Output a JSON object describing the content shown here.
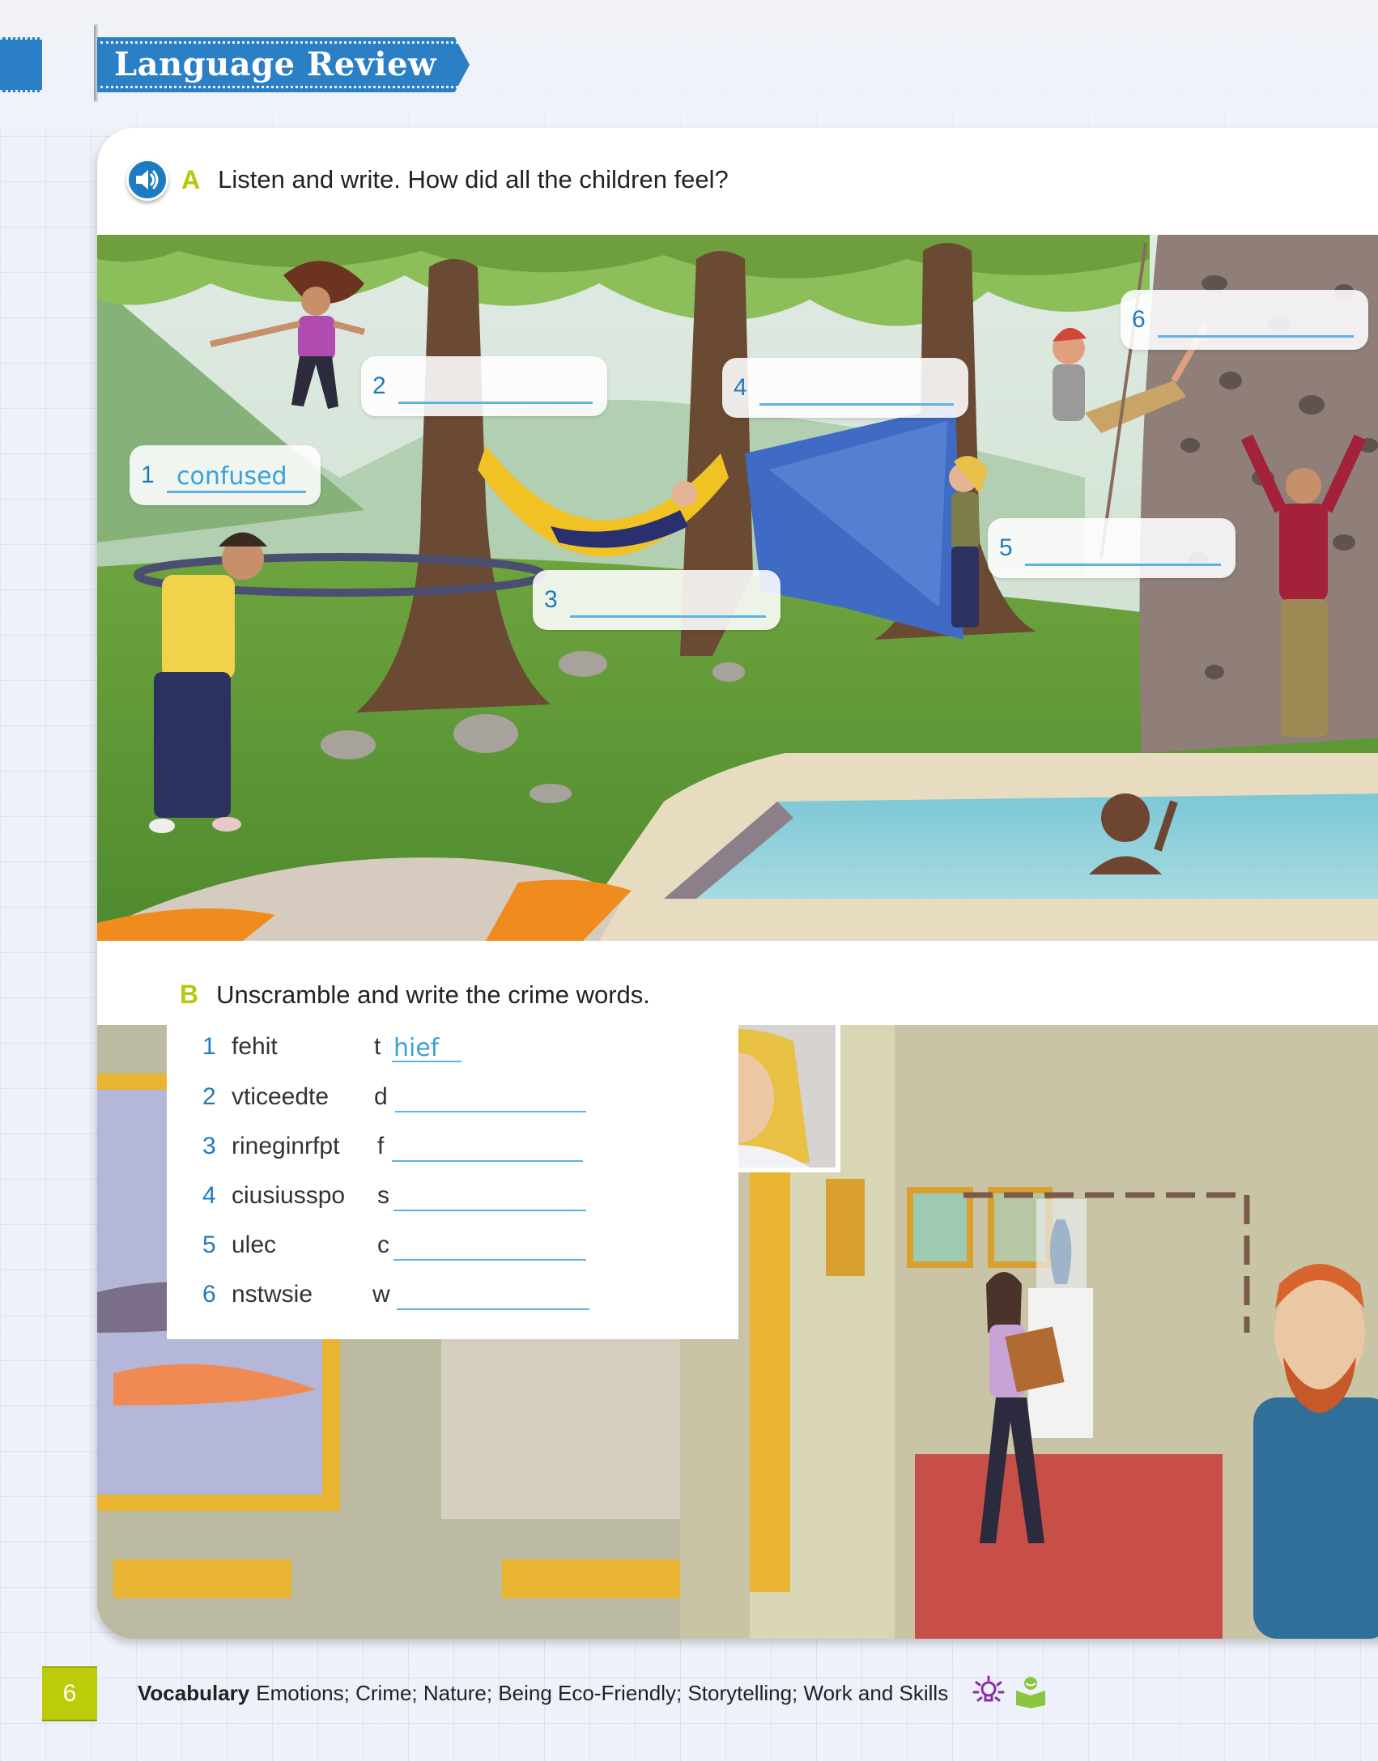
{
  "header": {
    "title": "Language Review"
  },
  "section_a": {
    "letter": "A",
    "instruction": "Listen and write. How did all the children feel?",
    "audio_icon": "speaker-icon",
    "items": [
      {
        "number": "1",
        "answer": "confused"
      },
      {
        "number": "2",
        "answer": ""
      },
      {
        "number": "3",
        "answer": ""
      },
      {
        "number": "4",
        "answer": ""
      },
      {
        "number": "5",
        "answer": ""
      },
      {
        "number": "6",
        "answer": ""
      }
    ]
  },
  "section_b": {
    "letter": "B",
    "instruction": "Unscramble and write the crime words.",
    "items": [
      {
        "number": "1",
        "scrambled": "fehit",
        "first_letter": "t",
        "answer": "hief"
      },
      {
        "number": "2",
        "scrambled": "vticeedte",
        "first_letter": "d",
        "answer": ""
      },
      {
        "number": "3",
        "scrambled": "rineginrfpt",
        "first_letter": "f",
        "answer": ""
      },
      {
        "number": "4",
        "scrambled": "ciusiusspo",
        "first_letter": "s",
        "answer": ""
      },
      {
        "number": "5",
        "scrambled": "ulec",
        "first_letter": "c",
        "answer": ""
      },
      {
        "number": "6",
        "scrambled": "nstwsie",
        "first_letter": "w",
        "answer": ""
      }
    ]
  },
  "footer": {
    "page_number": "6",
    "vocab_label": "Vocabulary",
    "vocab_topics": "Emotions; Crime; Nature; Being Eco-Friendly; Storytelling; Work and Skills",
    "icons": [
      "lightbulb-icon",
      "reading-child-icon"
    ]
  },
  "colors": {
    "brand_blue": "#2b80c5",
    "accent_green": "#bccb0a",
    "answer_blue": "#3aa0dc",
    "icon_purple": "#8a2ea8",
    "icon_green": "#8cc63f"
  }
}
